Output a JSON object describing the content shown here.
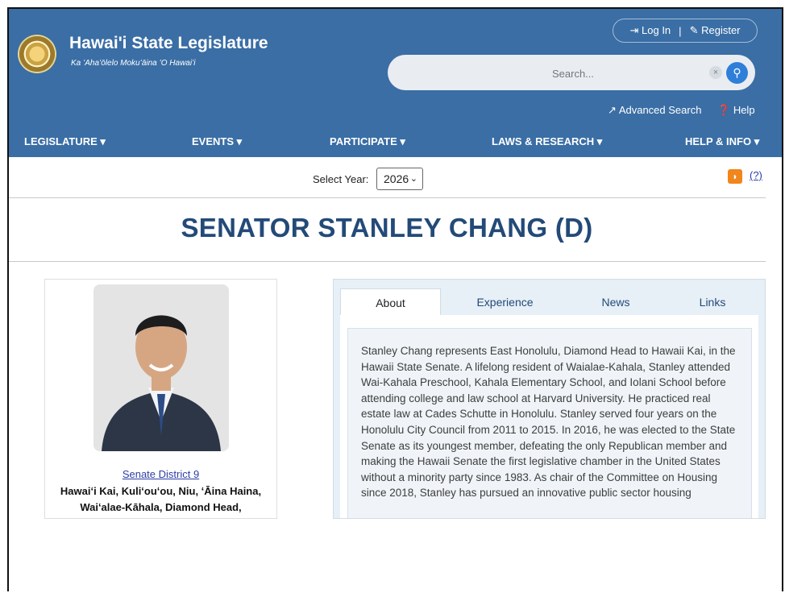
{
  "site": {
    "title": "Hawai'i State Legislature",
    "subtitle": "Ka ʻAhaʻōlelo Mokuʻāina ʻO Hawaiʻi"
  },
  "auth": {
    "login": "Log In",
    "separator": "|",
    "register": "Register"
  },
  "search": {
    "placeholder": "Search..."
  },
  "utility": {
    "advanced": "Advanced Search",
    "help": "Help"
  },
  "nav": {
    "items": [
      "LEGISLATURE ▾",
      "EVENTS ▾",
      "PARTICIPATE ▾",
      "LAWS & RESEARCH ▾",
      "HELP & INFO ▾"
    ]
  },
  "year": {
    "label": "Select Year:",
    "value": "2026"
  },
  "rss": {
    "help": "(?)"
  },
  "page": {
    "title": "SENATOR STANLEY CHANG (D)"
  },
  "profile": {
    "district": "Senate District 9",
    "areas_line1": "Hawaiʻi Kai, Kuliʻouʻou, Niu, ʻĀina Haina,",
    "areas_line2": "Waiʻalae-Kāhala, Diamond Head,"
  },
  "tabs": [
    "About",
    "Experience",
    "News",
    "Links"
  ],
  "about": {
    "text": "Stanley Chang represents East Honolulu, Diamond Head to Hawaii Kai, in the Hawaii State Senate. A lifelong resident of Waialae-Kahala, Stanley attended Wai-Kahala Preschool, Kahala Elementary School, and Iolani School before attending college and law school at Harvard University. He practiced real estate law at Cades Schutte in Honolulu. Stanley served four years on the Honolulu City Council from 2011 to 2015. In 2016, he was elected to the State Senate as its youngest member, defeating the only Republican member and making the Hawaii Senate the first legislative chamber in the United States without a minority party since 1983. As chair of the Committee on Housing since 2018, Stanley has pursued an innovative public sector housing"
  },
  "colors": {
    "header": "#3a6ea5",
    "title": "#234a78",
    "link": "#2c3da6",
    "accent": "#2f7fd9"
  }
}
